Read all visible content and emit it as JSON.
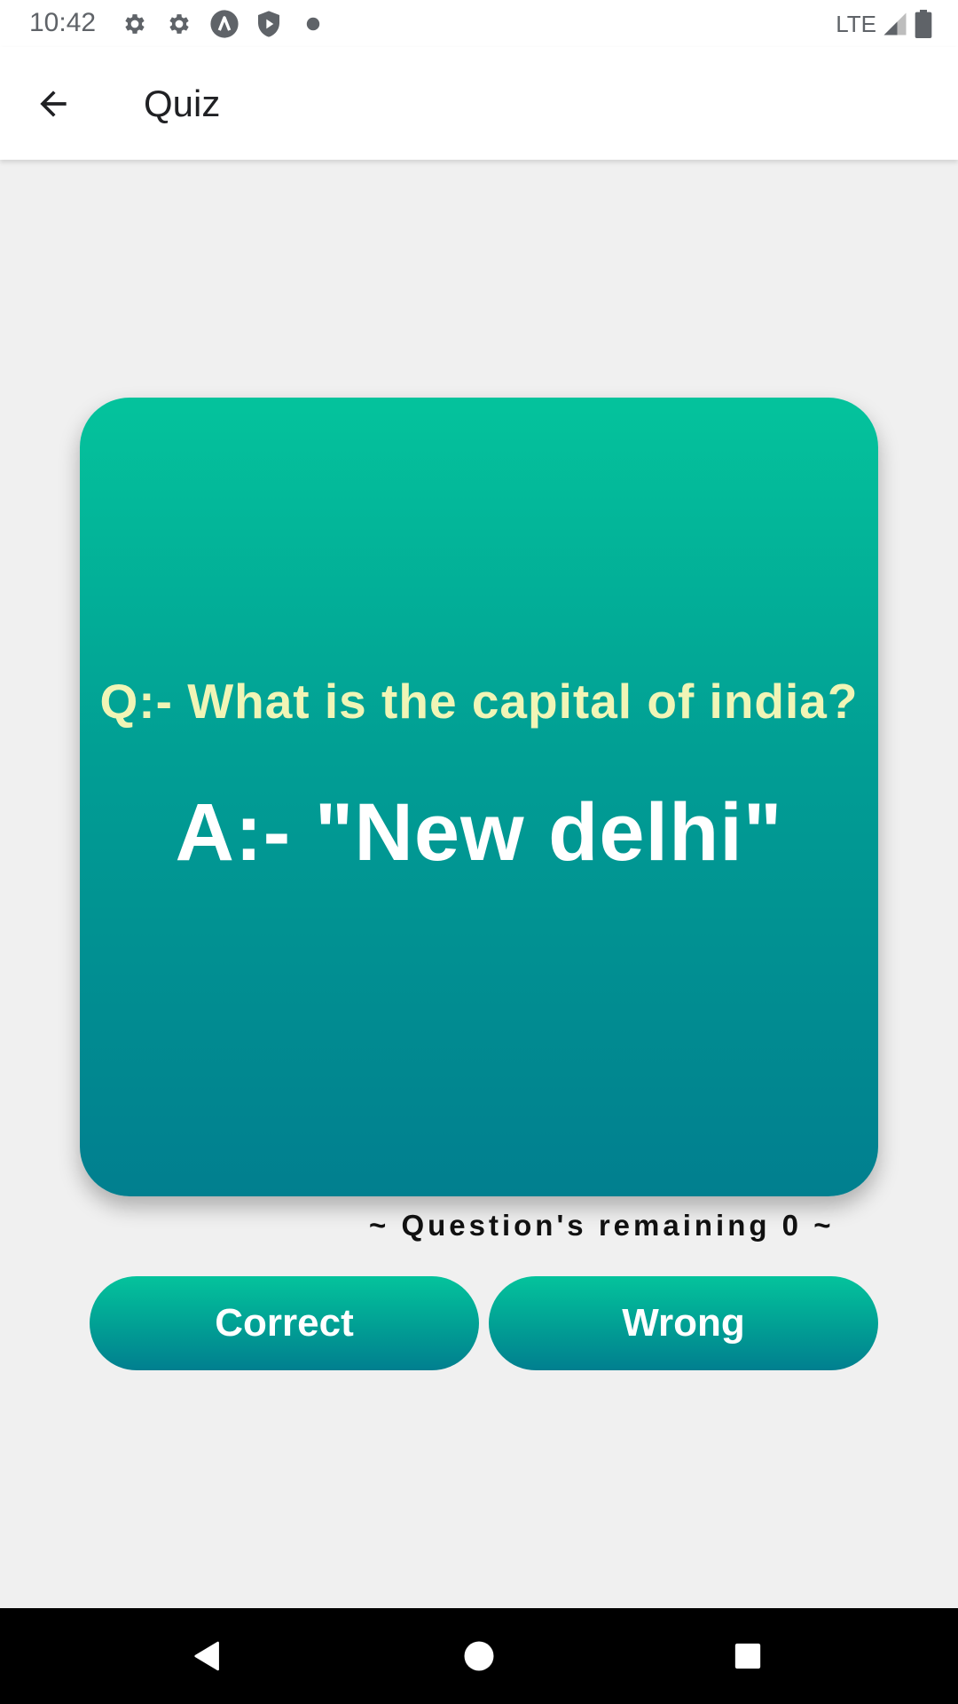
{
  "status_bar": {
    "time": "10:42",
    "network": "LTE",
    "icons": [
      "gear-icon",
      "gear-icon",
      "a-icon",
      "shield-play-icon",
      "dot-icon",
      "signal-icon",
      "battery-icon"
    ]
  },
  "app_bar": {
    "title": "Quiz",
    "back_icon": "arrow-back-icon"
  },
  "quiz": {
    "question": "Q:- What is the capital of india?",
    "answer": "A:- \"New delhi\"",
    "remaining": "~ Question's remaining 0 ~"
  },
  "buttons": {
    "correct_label": "Correct",
    "wrong_label": "Wrong"
  },
  "nav": {
    "back": "nav-back-icon",
    "home": "nav-home-icon",
    "recents": "nav-recents-icon"
  },
  "colors": {
    "card_top": "#04c39c",
    "card_bottom": "#017f8f",
    "question_text": "#f0f5b6",
    "background": "#f0f0f0"
  }
}
